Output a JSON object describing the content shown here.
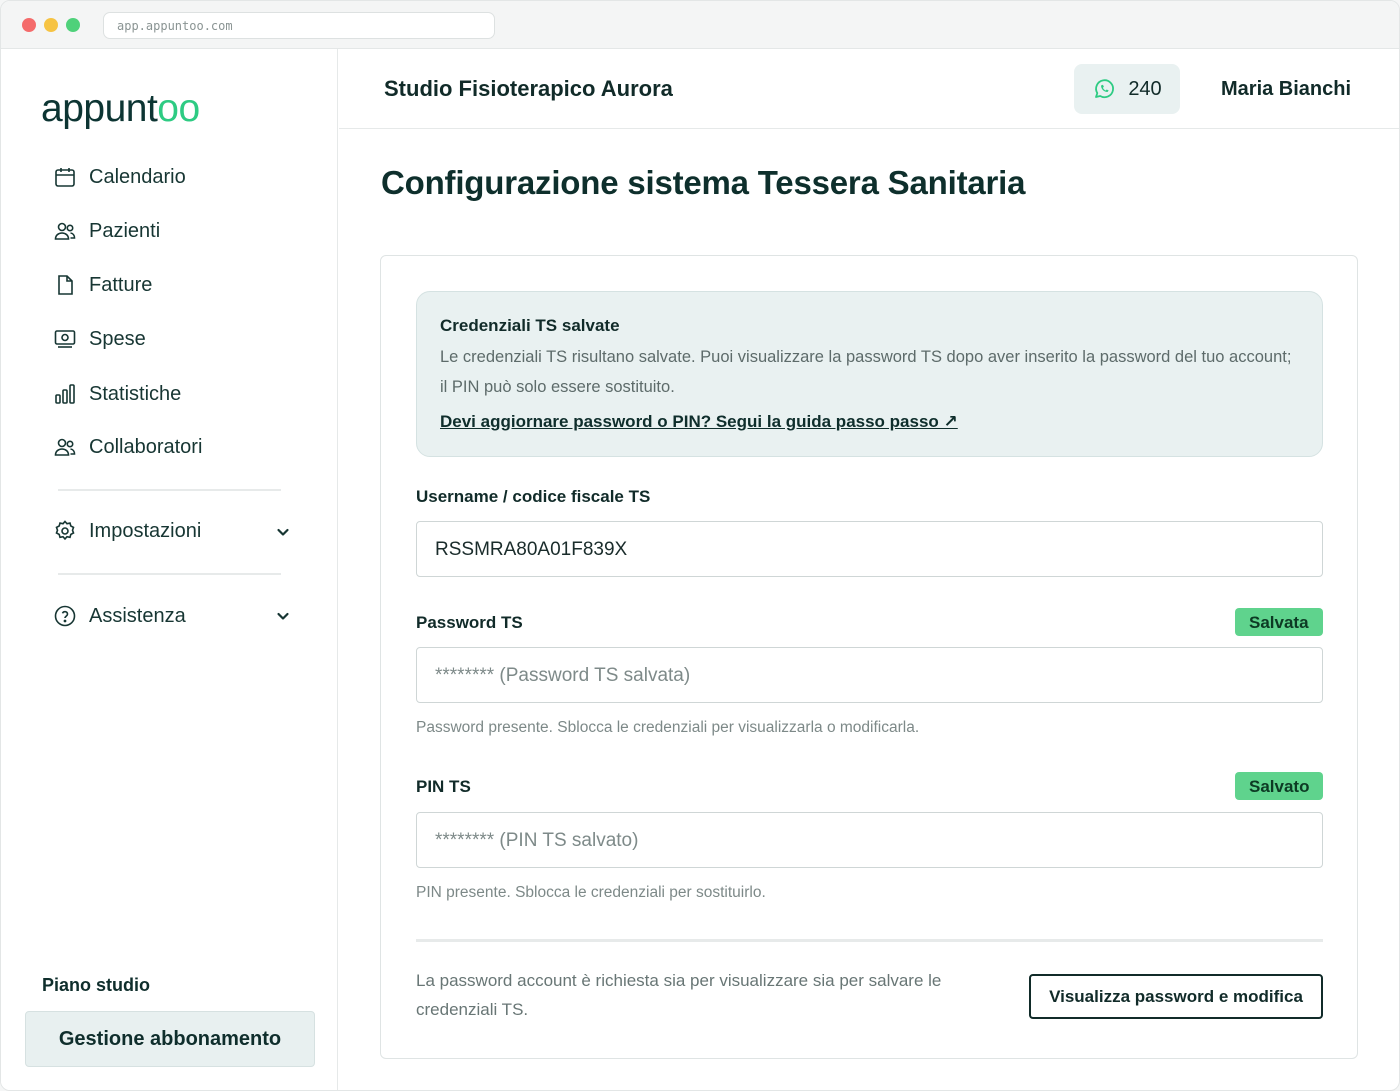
{
  "browser": {
    "url": "app.appuntoo.com"
  },
  "sidebar": {
    "logo_main": "appunt",
    "logo_accent": "oo",
    "items": [
      {
        "label": "Calendario",
        "icon": "calendar-icon"
      },
      {
        "label": "Pazienti",
        "icon": "users-icon"
      },
      {
        "label": "Fatture",
        "icon": "document-icon"
      },
      {
        "label": "Spese",
        "icon": "receipt-icon"
      },
      {
        "label": "Statistiche",
        "icon": "bar-chart-icon"
      },
      {
        "label": "Collaboratori",
        "icon": "team-icon"
      }
    ],
    "settings_label": "Impostazioni",
    "support_label": "Assistenza",
    "plan_label": "Piano studio",
    "subscription_button": "Gestione abbonamento"
  },
  "header": {
    "studio_name": "Studio Fisioterapico Aurora",
    "whatsapp_count": "240",
    "user_name": "Maria Bianchi"
  },
  "main": {
    "title": "Configurazione sistema Tessera Sanitaria",
    "info": {
      "title": "Credenziali TS salvate",
      "text": "Le credenziali TS risultano salvate. Puoi visualizzare la password TS dopo aver inserito la password del tuo account; il PIN può solo essere sostituito.",
      "link": "Devi aggiornare password o PIN? Segui la guida passo passo ↗"
    },
    "username": {
      "label": "Username / codice fiscale TS",
      "value": "RSSMRA80A01F839X"
    },
    "password": {
      "label": "Password TS",
      "badge": "Salvata",
      "placeholder": "******** (Password TS salvata)",
      "hint": "Password presente. Sblocca le credenziali per visualizzarla o modificarla."
    },
    "pin": {
      "label": "PIN TS",
      "badge": "Salvato",
      "placeholder": "******** (PIN TS salvato)",
      "hint": "PIN presente. Sblocca le credenziali per sostituirlo."
    },
    "footer_text": "La password account è richiesta sia per visualizzare sia per salvare le credenziali TS.",
    "action_button": "Visualizza password e modifica"
  },
  "colors": {
    "accent_green": "#2ecb83",
    "badge_green": "#5fd38d",
    "dark_text": "#0f2e2c",
    "info_bg": "#e9f1f1"
  }
}
